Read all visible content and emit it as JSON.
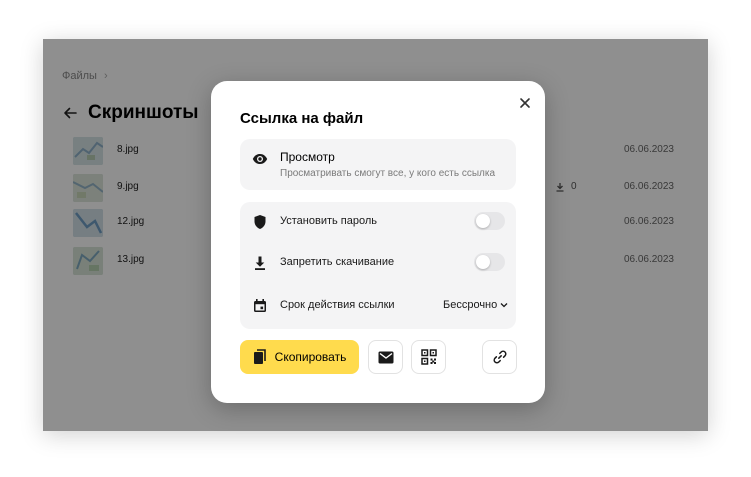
{
  "breadcrumb": {
    "root": "Файлы",
    "separator": "›"
  },
  "folder": {
    "title": "Скриншоты"
  },
  "files": [
    {
      "name": "8.jpg",
      "date": "06.06.2023",
      "downloads": ""
    },
    {
      "name": "9.jpg",
      "date": "06.06.2023",
      "downloads": "0"
    },
    {
      "name": "12.jpg",
      "date": "06.06.2023",
      "downloads": ""
    },
    {
      "name": "13.jpg",
      "date": "06.06.2023",
      "downloads": ""
    }
  ],
  "dialog": {
    "title": "Ссылка на файл",
    "access": {
      "title": "Просмотр",
      "description": "Просматривать смогут все, у кого есть ссылка",
      "icon": "eye-icon"
    },
    "settings": {
      "password": {
        "label": "Установить пароль",
        "enabled": false,
        "icon": "shield-icon"
      },
      "no_download": {
        "label": "Запретить скачивание",
        "enabled": false,
        "icon": "download-icon"
      },
      "expiry": {
        "label": "Срок действия ссылки",
        "value": "Бессрочно",
        "icon": "calendar-icon"
      }
    },
    "actions": {
      "copy_label": "Скопировать",
      "copy_icon": "copy-icon",
      "mail_icon": "mail-icon",
      "qr_icon": "qr-code-icon",
      "link_icon": "link-icon"
    }
  },
  "colors": {
    "accent": "#ffdb4d",
    "overlay": "rgba(0,0,0,0.44)",
    "card_bg": "#f4f4f5"
  }
}
